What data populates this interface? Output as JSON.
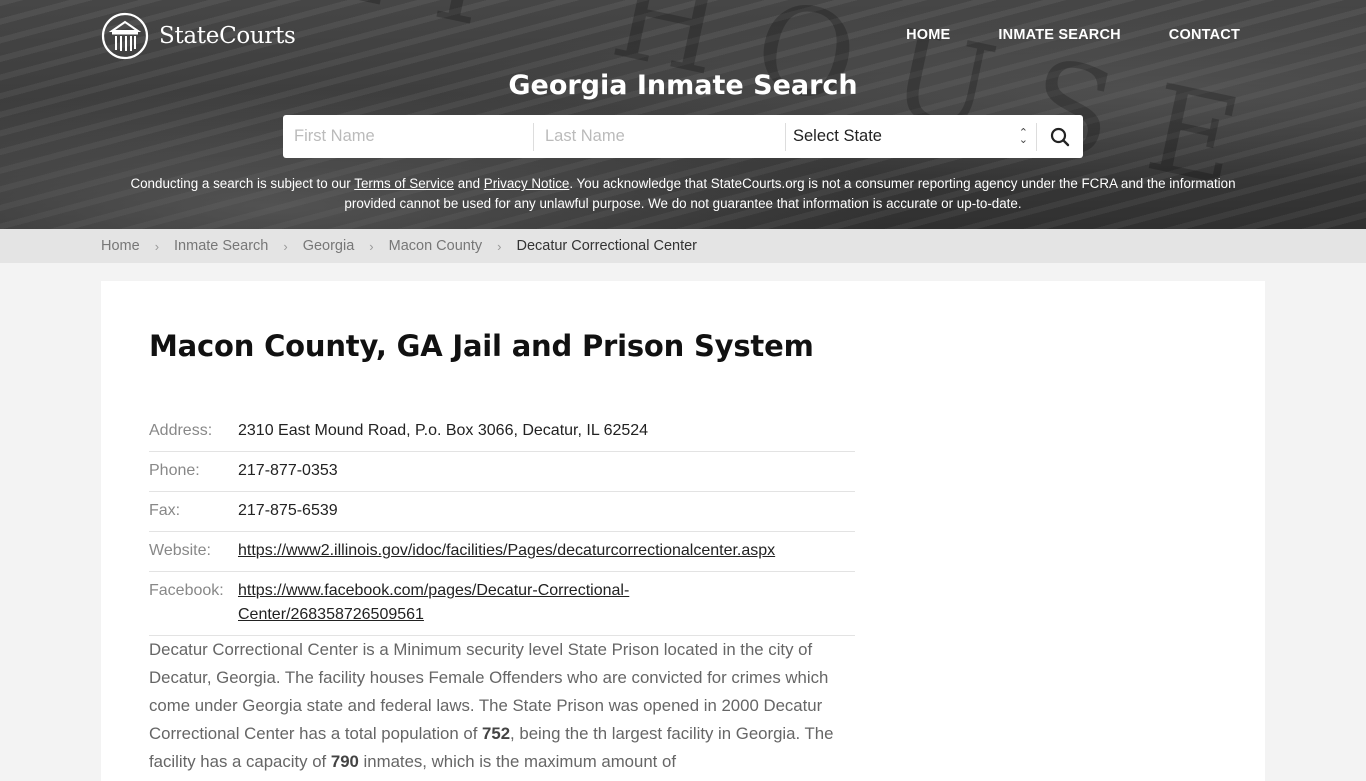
{
  "header": {
    "logo_text": "StateCourts",
    "nav": [
      {
        "label": "HOME"
      },
      {
        "label": "INMATE SEARCH"
      },
      {
        "label": "CONTACT"
      }
    ],
    "hero_title": "Georgia Inmate Search",
    "search": {
      "first_name_placeholder": "First Name",
      "last_name_placeholder": "Last Name",
      "state_select_value": "Select State",
      "search_icon": "search-icon"
    },
    "disclaimer": {
      "part1": "Conducting a search is subject to our ",
      "terms_link": "Terms of Service",
      "part2": " and ",
      "privacy_link": "Privacy Notice",
      "part3": ". You acknowledge that StateCourts.org is not a consumer reporting agency under the FCRA and the information provided cannot be used for any unlawful purpose. We do not guarantee that information is accurate or up-to-date."
    }
  },
  "breadcrumb": {
    "items": [
      {
        "label": "Home"
      },
      {
        "label": "Inmate Search"
      },
      {
        "label": "Georgia"
      },
      {
        "label": "Macon County"
      }
    ],
    "current": "Decatur Correctional Center"
  },
  "main": {
    "title": "Macon County, GA Jail and Prison System",
    "info": {
      "address_label": "Address:",
      "address": "2310 East Mound Road, P.o. Box 3066, Decatur, IL 62524",
      "phone_label": "Phone:",
      "phone": "217-877-0353",
      "fax_label": "Fax:",
      "fax": "217-875-6539",
      "website_label": "Website:",
      "website": "https://www2.illinois.gov/idoc/facilities/Pages/decaturcorrectionalcenter.aspx",
      "facebook_label": "Facebook:",
      "facebook": "https://www.facebook.com/pages/Decatur-Correctional-Center/268358726509561"
    },
    "description": {
      "part1": "Decatur Correctional Center is a Minimum security level State Prison located in the city of Decatur, Georgia. The facility houses Female Offenders who are convicted for crimes which come under Georgia state and federal laws. The State Prison was opened in 2000 Decatur Correctional Center has a total population of ",
      "population": "752",
      "part2": ", being the th largest facility in Georgia. The facility has a capacity of ",
      "capacity": "790",
      "part3": " inmates, which is the maximum amount of"
    }
  }
}
